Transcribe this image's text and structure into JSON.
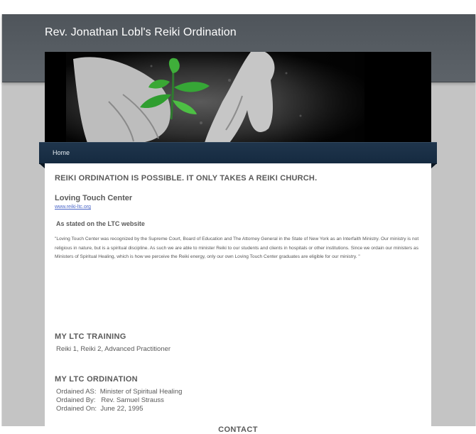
{
  "site": {
    "title": "Rev. Jonathan Lobl's Reiki Ordination"
  },
  "nav": {
    "items": [
      {
        "label": "Home"
      }
    ]
  },
  "content": {
    "heading": "REIKI ORDINATION IS POSSIBLE.  IT ONLY TAKES A REIKI CHURCH.",
    "ltc_name": "Loving Touch Center",
    "ltc_link": "www.reiki-ltc.org",
    "stated": "As stated on the LTC website",
    "quote": "\"Loving Touch Center was recognized by the Supreme Court, Board of Education and The Attorney General in the State of New York as an Interfaith Ministry. Our ministry is not religious in nature, but is a spiritual discipline. As such we are able to minister Reiki to our students and clients in hospitals or other institutions. Since we ordain our ministers as Ministers of Spiritual Healing, which is how we perceive the Reiki energy, only our own Loving Touch Center graduates are eligible for our ministry. \"",
    "training": {
      "title": "MY LTC TRAINING",
      "text": "Reiki 1, Reiki 2, Advanced Practitioner"
    },
    "ordination": {
      "title": "MY LTC ORDINATION",
      "rows": [
        {
          "label": "Ordained AS:",
          "value": "Minister of Spiritual Healing"
        },
        {
          "label": "Ordained By:",
          "value": "Rev. Samuel Strauss"
        },
        {
          "label": "Ordained On:",
          "value": "June 22, 1995"
        }
      ]
    },
    "contact": "CONTACT"
  },
  "banner": {
    "image": "hands-planting-seedling",
    "colors": {
      "leaf": "#2f9e2f",
      "soil": "#3a3a3a"
    }
  }
}
